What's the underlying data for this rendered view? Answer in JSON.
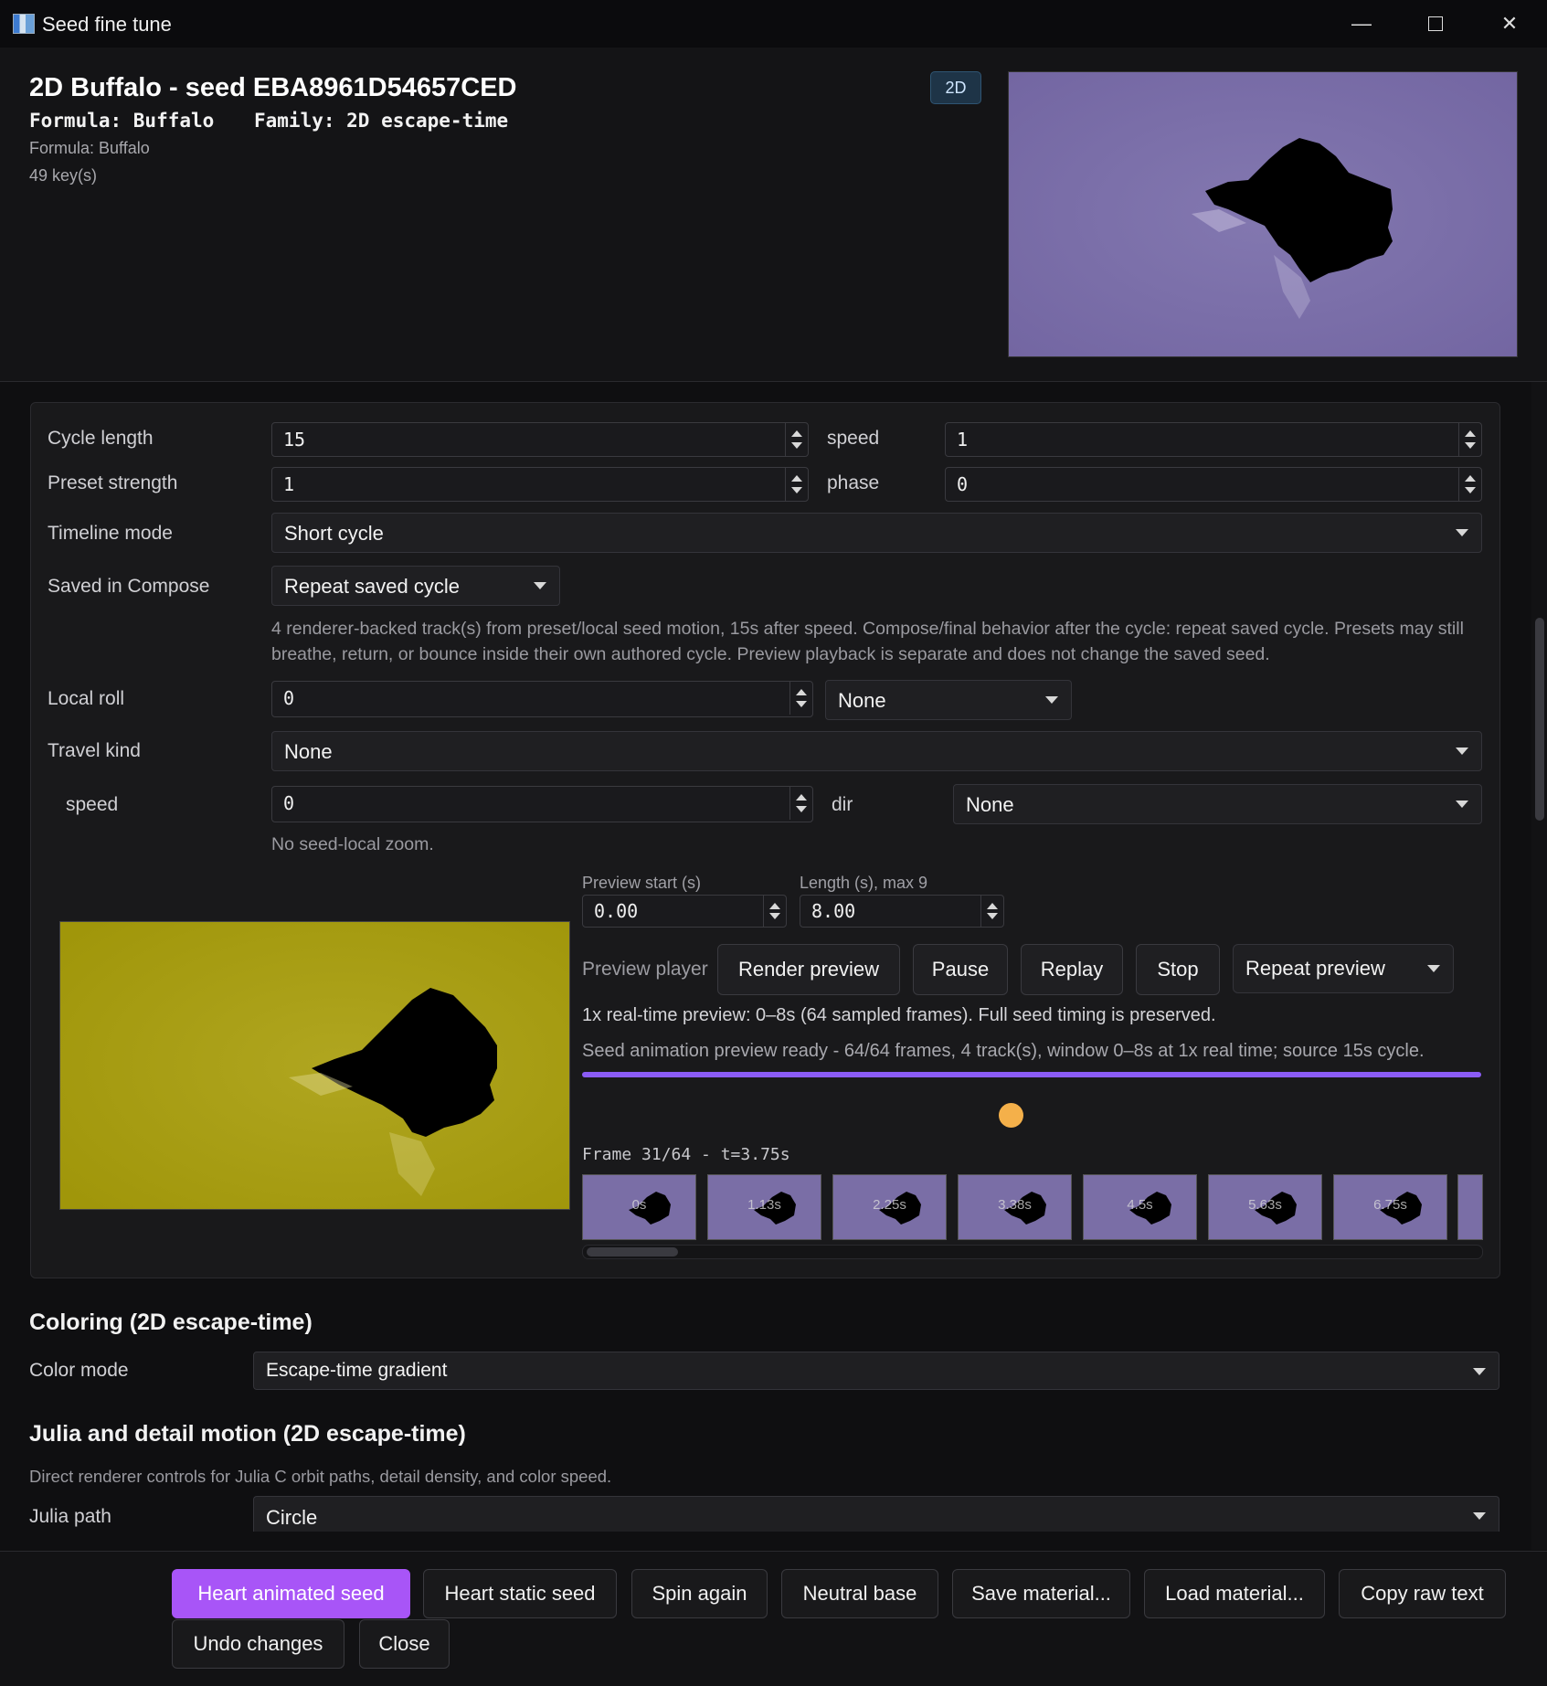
{
  "window": {
    "title": "Seed fine tune"
  },
  "header": {
    "title": "2D Buffalo - seed EBA8961D54657CED",
    "formula_mono": "Formula: Buffalo",
    "family_mono": "Family: 2D escape-time",
    "formula_sub": "Formula: Buffalo",
    "keys": "49 key(s)",
    "badge": "2D"
  },
  "motion": {
    "cycle_length_label": "Cycle length",
    "cycle_length": "15",
    "speed_label": "speed",
    "speed": "1",
    "preset_strength_label": "Preset strength",
    "preset_strength": "1",
    "phase_label": "phase",
    "phase": "0",
    "timeline_mode_label": "Timeline mode",
    "timeline_mode": "Short cycle",
    "saved_in_compose_label": "Saved in Compose",
    "saved_in_compose": "Repeat saved cycle",
    "saved_help": "4 renderer-backed track(s) from preset/local seed motion, 15s after speed. Compose/final behavior after the cycle: repeat saved cycle. Presets may still breathe, return, or bounce inside their own authored cycle. Preview playback is separate and does not change the saved seed.",
    "local_roll_label": "Local roll",
    "local_roll": "0",
    "local_roll_mode": "None",
    "travel_kind_label": "Travel kind",
    "travel_kind": "None",
    "travel_speed_label": "speed",
    "travel_speed": "0",
    "dir_label": "dir",
    "dir": "None",
    "zoom_help": "No seed-local zoom."
  },
  "preview": {
    "start_label": "Preview start (s)",
    "start": "0.00",
    "length_label": "Length (s), max 9",
    "length": "8.00",
    "player_label": "Preview player",
    "render_btn": "Render preview",
    "pause_btn": "Pause",
    "replay_btn": "Replay",
    "stop_btn": "Stop",
    "repeat_mode": "Repeat preview",
    "info": "1x real-time preview: 0–8s (64 sampled frames). Full seed timing is preserved.",
    "status": "Seed animation preview ready - 64/64 frames, 4 track(s), window 0–8s at 1x real time; source 15s cycle.",
    "progress": 1.0,
    "frame_label": "Frame 31/64 - t=3.75s",
    "thumbnails": [
      "0s",
      "1.13s",
      "2.25s",
      "3.38s",
      "4.5s",
      "5.63s",
      "6.75s"
    ]
  },
  "coloring": {
    "title": "Coloring (2D escape-time)",
    "color_mode_label": "Color mode",
    "color_mode": "Escape-time gradient"
  },
  "julia": {
    "title": "Julia and detail motion (2D escape-time)",
    "help": "Direct renderer controls for Julia C orbit paths, detail density, and color speed.",
    "path_label": "Julia path",
    "path": "Circle"
  },
  "footer": {
    "heart_animated": "Heart animated seed",
    "heart_static": "Heart static seed",
    "spin_again": "Spin again",
    "neutral_base": "Neutral base",
    "save_material": "Save material...",
    "load_material": "Load material...",
    "copy_raw": "Copy raw text",
    "undo": "Undo changes",
    "close": "Close"
  },
  "colors": {
    "accent": "#a855f7",
    "progress": "#8b5cf6",
    "playhead": "#f4b04a",
    "header_preview_bg": "#7a6ea6",
    "main_preview_bg": "#a49a0e"
  }
}
